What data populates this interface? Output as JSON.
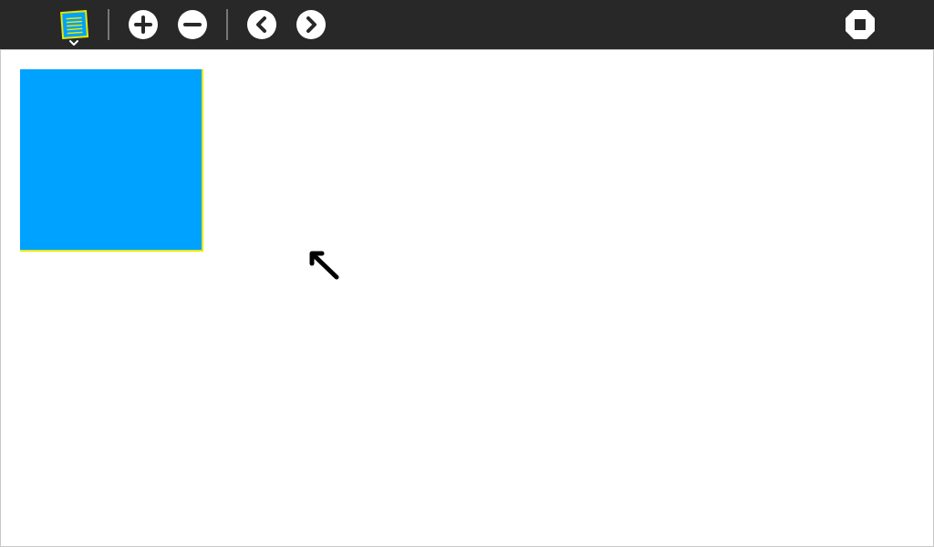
{
  "toolbar": {
    "background": "#282828",
    "buttons": [
      {
        "name": "journal-menu-button",
        "icon": "journal-notebook-icon"
      },
      {
        "name": "add-button",
        "icon": "plus-circle-icon"
      },
      {
        "name": "remove-button",
        "icon": "minus-circle-icon"
      },
      {
        "name": "previous-button",
        "icon": "chevron-left-circle-icon"
      },
      {
        "name": "next-button",
        "icon": "chevron-right-circle-icon"
      },
      {
        "name": "stop-button",
        "icon": "stop-octagon-icon"
      }
    ]
  },
  "canvas": {
    "background": "#ffffff",
    "square": {
      "fill": "#00a2ff",
      "stroke": "#e8e800"
    },
    "cursor_icon": "arrow-cursor-icon"
  }
}
